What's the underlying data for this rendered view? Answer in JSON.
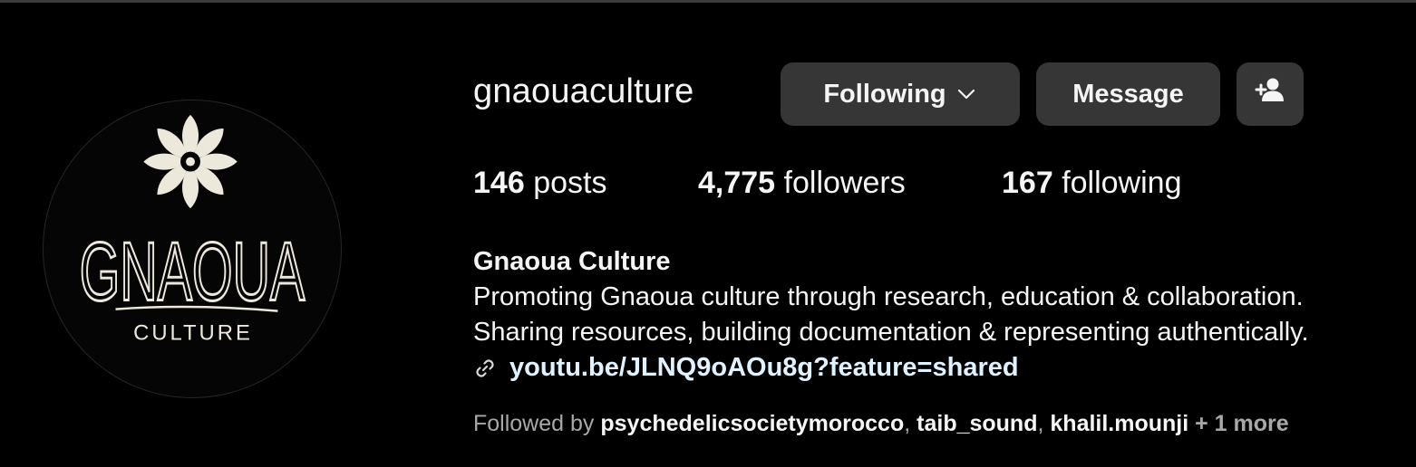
{
  "profile": {
    "username": "gnaouaculture",
    "full_name": "Gnaoua Culture",
    "avatar_text": {
      "main": "GNAOUA",
      "sub": "CULTURE"
    }
  },
  "actions": {
    "following_label": "Following",
    "message_label": "Message",
    "add_user_icon": "add-user-icon"
  },
  "stats": {
    "posts_count": "146",
    "posts_label": "posts",
    "followers_count": "4,775",
    "followers_label": "followers",
    "following_count": "167",
    "following_label": "following"
  },
  "bio": {
    "line1": "Promoting Gnaoua culture through research, education & collaboration.",
    "line2": "Sharing resources, building documentation & representing authentically.",
    "link": "youtu.be/JLNQ9oAOu8g?feature=shared"
  },
  "followed_by": {
    "prefix": "Followed by ",
    "names": [
      "psychedelicsocietymorocco",
      "taib_sound",
      "khalil.mounji"
    ],
    "separator": ", ",
    "more": " + 1 more"
  },
  "colors": {
    "background": "#000000",
    "button": "#363636",
    "link": "#e0f1ff",
    "muted": "#a8a8a8"
  }
}
